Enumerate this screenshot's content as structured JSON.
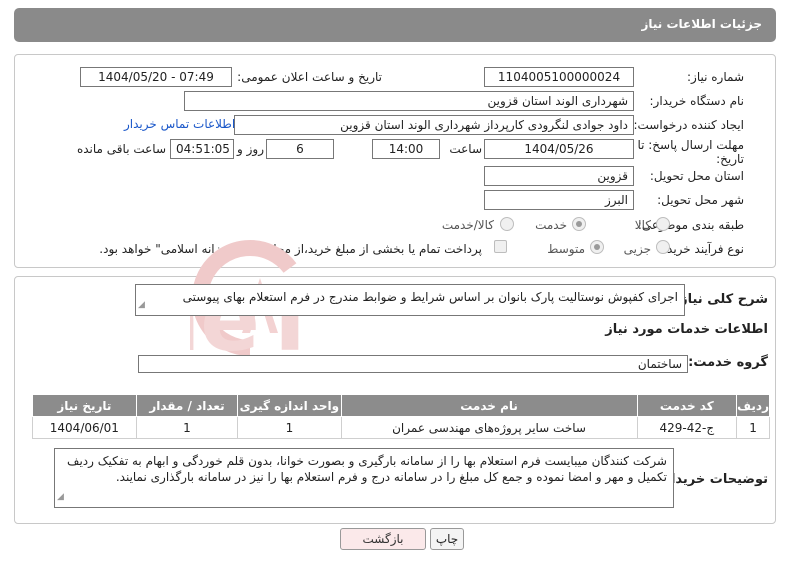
{
  "header": {
    "title": "جزئیات اطلاعات نیاز"
  },
  "form": {
    "need_number_label": "شماره نیاز:",
    "need_number": "1104005100000024",
    "announce_label": "تاریخ و ساعت اعلان عمومی:",
    "announce_value": "1404/05/20 - 07:49",
    "buyer_org_label": "نام دستگاه خریدار:",
    "buyer_org": "شهرداری الوند استان قزوین",
    "creator_label": "ایجاد کننده درخواست:",
    "creator": "داود جوادی لنگرودی کارپرداز شهرداری الوند استان قزوین",
    "contact_link": "اطلاعات تماس خریدار",
    "deadline_label_1": "مهلت ارسال پاسخ: تا",
    "deadline_label_2": "تاریخ:",
    "deadline_date": "1404/05/26",
    "time_label": "ساعت",
    "deadline_time": "14:00",
    "days_value": "6",
    "days_label": "روز و",
    "remaining_time": "04:51:05",
    "remaining_label": "ساعت باقی مانده",
    "province_label": "استان محل تحویل:",
    "province": "قزوین",
    "city_label": "شهر محل تحویل:",
    "city": "البرز",
    "category_label": "طبقه بندی موضوعی:",
    "category_options": [
      "کالا",
      "خدمت",
      "کالا/خدمت"
    ],
    "category_selected": "خدمت",
    "process_label": "نوع فرآیند خرید :",
    "process_options": [
      "جزیی",
      "متوسط"
    ],
    "process_selected": "متوسط",
    "treasury_note": "پرداخت تمام یا بخشی از مبلغ خرید،از محل \"اسناد خزانه اسلامی\" خواهد بود."
  },
  "need": {
    "summary_label": "شرح کلی نیاز:",
    "summary": "اجرای کفپوش نوستالیت پارک بانوان بر اساس شرایط و ضوابط مندرج در فرم استعلام بهای پیوستی",
    "services_heading": "اطلاعات خدمات مورد نیاز",
    "service_group_label": "گروه خدمت:",
    "service_group": "ساختمان"
  },
  "table": {
    "headers": [
      "ردیف",
      "کد خدمت",
      "نام خدمت",
      "واحد اندازه گیری",
      "تعداد / مقدار",
      "تاریخ نیاز"
    ],
    "rows": [
      [
        "1",
        "ج-42-429",
        "ساخت سایر پروژه‌های مهندسی عمران",
        "1",
        "1",
        "1404/06/01"
      ]
    ]
  },
  "buyer_notes": {
    "label": "توضیحات خریدار:",
    "text": "شرکت کنندگان میبایست فرم استعلام بها را از سامانه بارگیری و بصورت خوانا، بدون قلم خوردگی و ابهام به تفکیک ردیف تکمیل و مهر و امضا نموده و جمع کل مبلغ را در سامانه درج و فرم استعلام بها را نیز در سامانه بارگذاری نمایند."
  },
  "buttons": {
    "print": "چاپ",
    "back": "بازگشت"
  },
  "watermark": {
    "text": "AriaTender.neT"
  },
  "colors": {
    "title_bar": "#8a8a8a",
    "link": "#1a57c9",
    "table_header": "#8c8c8c",
    "back_button": "#fbe9ea",
    "watermark": "#e8b3b3"
  }
}
